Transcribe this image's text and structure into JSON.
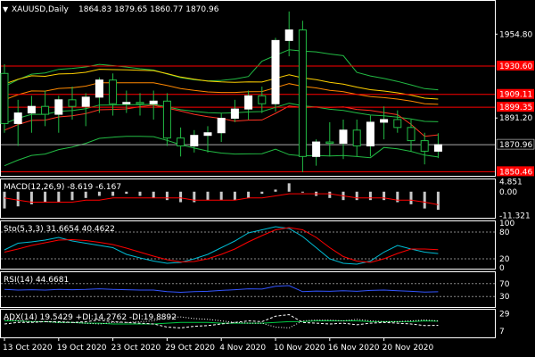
{
  "header": {
    "symbol": "XAUUSD,Daily",
    "ohlc": "1864.83 1879.65 1860.77 1870.96"
  },
  "colors": {
    "background": "#000000",
    "frame": "#ffffff",
    "bull_body": "#ffffff",
    "bear_body": "#000000",
    "hline": "#ff0000",
    "price_line": "#aaaaaa",
    "bollinger": "#22bb44",
    "ma_yellow": "#ffd000",
    "ma_red": "#ff3322",
    "ma_orange": "#ff8800",
    "macd_signal": "#ff0000",
    "stoch_main": "#00bcd4",
    "stoch_signal": "#ff0000",
    "rsi": "#3355ff",
    "adx": "#00cc44",
    "di_plus": "#ffffff",
    "di_minus": "#ffffff"
  },
  "price_axis": {
    "ticks": [
      "1954.80",
      "1891.20"
    ],
    "current_price": "1870.96"
  },
  "levels": [
    {
      "name": "level-1930",
      "label": "1930.60",
      "value": 1930.6
    },
    {
      "name": "level-1909",
      "label": "1909.11",
      "value": 1909.11
    },
    {
      "name": "level-1899",
      "label": "1899.35",
      "value": 1899.35
    },
    {
      "name": "level-1850",
      "label": "1850.46",
      "value": 1850.46
    }
  ],
  "date_axis": [
    "13 Oct 2020",
    "19 Oct 2020",
    "23 Oct 2020",
    "29 Oct 2020",
    "4 Nov 2020",
    "10 Nov 2020",
    "16 Nov 2020",
    "20 Nov 2020"
  ],
  "chart_data": [
    {
      "type": "candlestick",
      "title": "XAUUSD,Daily",
      "y_range": [
        1848,
        1978
      ],
      "ohlc": [
        [
          1925,
          1932,
          1880,
          1887
        ],
        [
          1887,
          1905,
          1870,
          1895
        ],
        [
          1895,
          1908,
          1880,
          1900
        ],
        [
          1900,
          1912,
          1885,
          1894
        ],
        [
          1894,
          1908,
          1880,
          1905
        ],
        [
          1905,
          1915,
          1890,
          1900
        ],
        [
          1900,
          1910,
          1885,
          1907
        ],
        [
          1907,
          1922,
          1895,
          1920
        ],
        [
          1920,
          1925,
          1893,
          1902
        ],
        [
          1902,
          1912,
          1895,
          1903
        ],
        [
          1903,
          1910,
          1893,
          1902
        ],
        [
          1902,
          1912,
          1890,
          1904
        ],
        [
          1904,
          1910,
          1870,
          1876
        ],
        [
          1876,
          1884,
          1862,
          1870
        ],
        [
          1870,
          1882,
          1865,
          1878
        ],
        [
          1878,
          1885,
          1865,
          1880
        ],
        [
          1880,
          1895,
          1873,
          1891
        ],
        [
          1891,
          1905,
          1888,
          1898
        ],
        [
          1898,
          1912,
          1890,
          1908
        ],
        [
          1908,
          1915,
          1895,
          1902
        ],
        [
          1902,
          1952,
          1896,
          1950
        ],
        [
          1950,
          1972,
          1938,
          1958
        ],
        [
          1958,
          1965,
          1850,
          1862
        ],
        [
          1862,
          1875,
          1855,
          1873
        ],
        [
          1873,
          1888,
          1862,
          1872
        ],
        [
          1872,
          1890,
          1860,
          1882
        ],
        [
          1882,
          1890,
          1862,
          1870
        ],
        [
          1870,
          1893,
          1862,
          1888
        ],
        [
          1888,
          1900,
          1875,
          1890
        ],
        [
          1890,
          1897,
          1880,
          1884
        ],
        [
          1884,
          1890,
          1866,
          1874
        ],
        [
          1874,
          1880,
          1856,
          1866
        ],
        [
          1866,
          1879.65,
          1860.77,
          1870.96
        ]
      ]
    },
    {
      "type": "bar",
      "title": "MACD(12,26,9)",
      "label": "MACD(12,26,9) -8.619 -6.167",
      "ticks": [
        "4.851",
        "0.00",
        "-11.321"
      ],
      "y_range": [
        -12,
        5
      ],
      "values": [
        -8,
        -7,
        -6,
        -5,
        -5,
        -4,
        -3,
        -2,
        -2,
        -1,
        -2,
        -3,
        -4,
        -5,
        -5,
        -4,
        -4,
        -4,
        -3,
        -1,
        1,
        4,
        0,
        -2,
        -3,
        -4,
        -4,
        -4,
        -4,
        -5,
        -6,
        -8,
        -8.6
      ],
      "signal": [
        -3,
        -4,
        -5,
        -5,
        -5,
        -5,
        -4,
        -4,
        -3,
        -3,
        -3,
        -3,
        -3,
        -3,
        -4,
        -4,
        -4,
        -4,
        -3,
        -3,
        -2,
        -1,
        -1,
        -1,
        -1,
        -2,
        -3,
        -3,
        -3,
        -4,
        -4,
        -5,
        -6.2
      ]
    },
    {
      "type": "line",
      "title": "Sto(5,3,3)",
      "label": "Sto(5,3,3) 31.6654 40.4622",
      "ticks": [
        "100",
        "80",
        "20",
        "0"
      ],
      "y_range": [
        0,
        100
      ],
      "series": [
        {
          "values": [
            40,
            55,
            58,
            62,
            68,
            60,
            55,
            50,
            45,
            30,
            22,
            15,
            10,
            12,
            20,
            30,
            45,
            60,
            78,
            85,
            92,
            88,
            70,
            45,
            20,
            10,
            8,
            15,
            35,
            50,
            42,
            35,
            31.7
          ]
        },
        {
          "values": [
            35,
            42,
            50,
            56,
            62,
            63,
            61,
            57,
            52,
            44,
            35,
            26,
            18,
            13,
            14,
            20,
            30,
            42,
            58,
            72,
            85,
            90,
            85,
            68,
            45,
            25,
            15,
            12,
            20,
            32,
            42,
            42,
            40.5
          ]
        }
      ]
    },
    {
      "type": "line",
      "title": "RSI(14)",
      "label": "RSI(14) 44.6681",
      "ticks": [
        "70",
        "30"
      ],
      "y_range": [
        0,
        100
      ],
      "series": [
        {
          "values": [
            52,
            50,
            51,
            50,
            52,
            51,
            52,
            54,
            52,
            51,
            50,
            50,
            45,
            43,
            45,
            46,
            49,
            51,
            54,
            53,
            62,
            64,
            45,
            47,
            46,
            48,
            46,
            49,
            50,
            48,
            46,
            44,
            44.7
          ]
        }
      ]
    },
    {
      "type": "line",
      "title": "ADX(14)",
      "label": "ADX(14) 19.5429 +DI:14.2762 -DI:19.8892",
      "ticks": [
        "29",
        "7"
      ],
      "y_range": [
        0,
        32
      ],
      "series": [
        {
          "values": [
            20,
            20,
            19,
            19,
            18,
            18,
            17,
            17,
            16,
            16,
            16,
            16,
            17,
            18,
            18,
            18,
            17,
            17,
            17,
            17,
            18,
            19,
            19,
            20,
            20,
            20,
            20,
            19,
            19,
            19,
            19,
            20,
            19.5
          ]
        },
        {
          "values": [
            16,
            18,
            18,
            19,
            19,
            18,
            19,
            21,
            19,
            18,
            17,
            16,
            12,
            11,
            13,
            14,
            16,
            18,
            20,
            19,
            26,
            28,
            18,
            17,
            16,
            17,
            15,
            17,
            18,
            17,
            16,
            14,
            14.3
          ]
        },
        {
          "values": [
            22,
            20,
            19,
            19,
            18,
            18,
            17,
            16,
            18,
            18,
            19,
            20,
            24,
            25,
            23,
            22,
            20,
            18,
            17,
            17,
            12,
            11,
            20,
            21,
            21,
            20,
            22,
            20,
            19,
            19,
            20,
            21,
            19.9
          ]
        }
      ]
    }
  ]
}
